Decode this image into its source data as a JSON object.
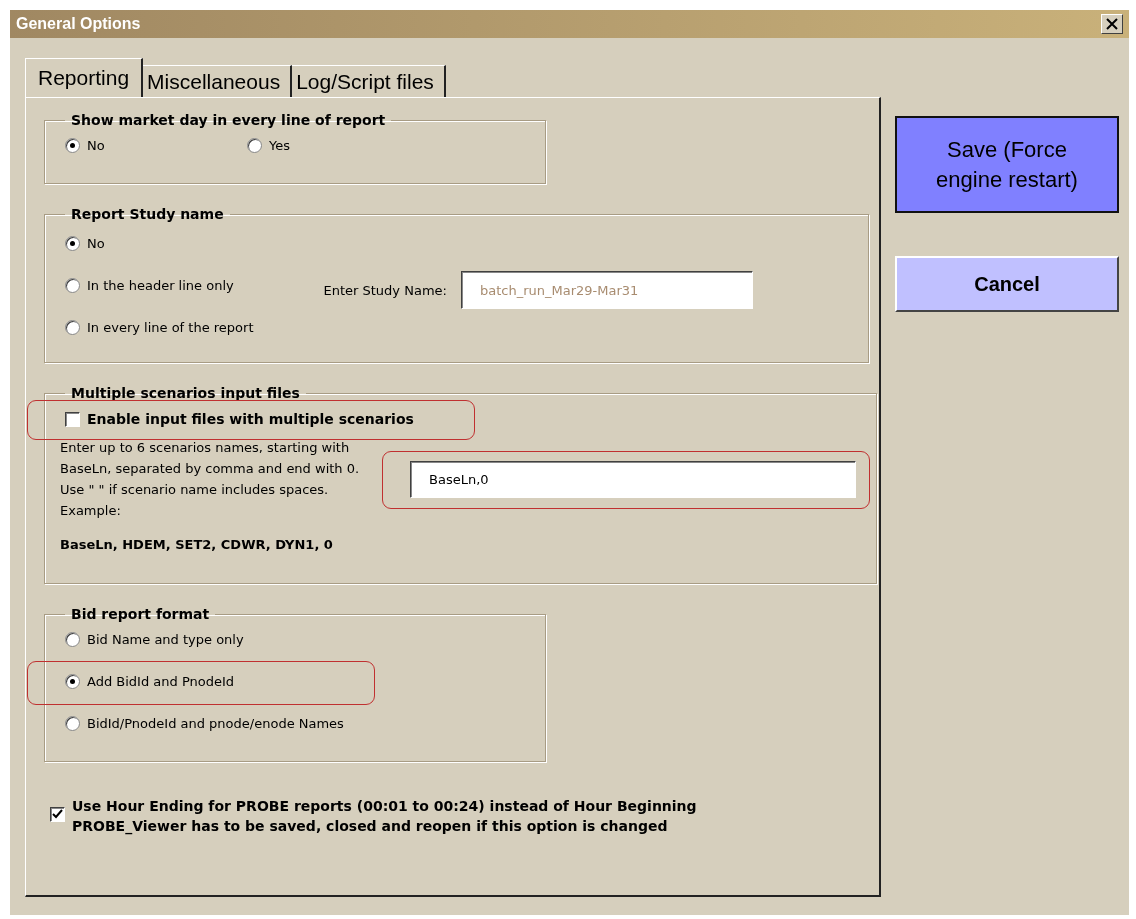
{
  "window": {
    "title": "General Options"
  },
  "tabs": [
    {
      "label": "Reporting",
      "selected": true
    },
    {
      "label": "Miscellaneous",
      "selected": false
    },
    {
      "label": "Log/Script files",
      "selected": false
    }
  ],
  "market_day": {
    "title": "Show market day in every line of report",
    "options": [
      {
        "label": "No",
        "selected": true
      },
      {
        "label": "Yes",
        "selected": false
      }
    ]
  },
  "study_name": {
    "title": "Report Study name",
    "options": [
      {
        "label": "No",
        "selected": true
      },
      {
        "label": "In the header line only",
        "selected": false
      },
      {
        "label": "In every line of the report",
        "selected": false
      }
    ],
    "field": {
      "label": "Enter Study Name:",
      "value": "batch_run_Mar29-Mar31",
      "disabled": true
    }
  },
  "scenarios": {
    "title": "Multiple scenarios input files",
    "checkbox": {
      "label": "Enable input files with multiple scenarios",
      "checked": false,
      "highlighted": true
    },
    "description": "Enter up to 6 scenarios names, starting with BaseLn, separated by comma and end with 0. Use \" \" if scenario name includes spaces. Example:",
    "example": "BaseLn, HDEM, SET2, CDWR, DYN1, 0",
    "field": {
      "value": "BaseLn,0",
      "highlighted": true
    }
  },
  "bid_format": {
    "title": "Bid report format",
    "options": [
      {
        "label": "Bid Name and type only",
        "selected": false,
        "highlighted": false
      },
      {
        "label": "Add BidId and PnodeId",
        "selected": true,
        "highlighted": true
      },
      {
        "label": "BidId/PnodeId and pnode/enode Names",
        "selected": false,
        "highlighted": false
      }
    ]
  },
  "hour_ending": {
    "checked": true,
    "lines": [
      "Use Hour Ending for PROBE reports (00:01 to 00:24) instead of Hour Beginning",
      "PROBE_Viewer has to be saved, closed and reopen if this option is changed"
    ]
  },
  "buttons": [
    {
      "label": "Save (Force engine restart)",
      "kind": "primary"
    },
    {
      "label": "Cancel",
      "kind": "secondary"
    }
  ]
}
